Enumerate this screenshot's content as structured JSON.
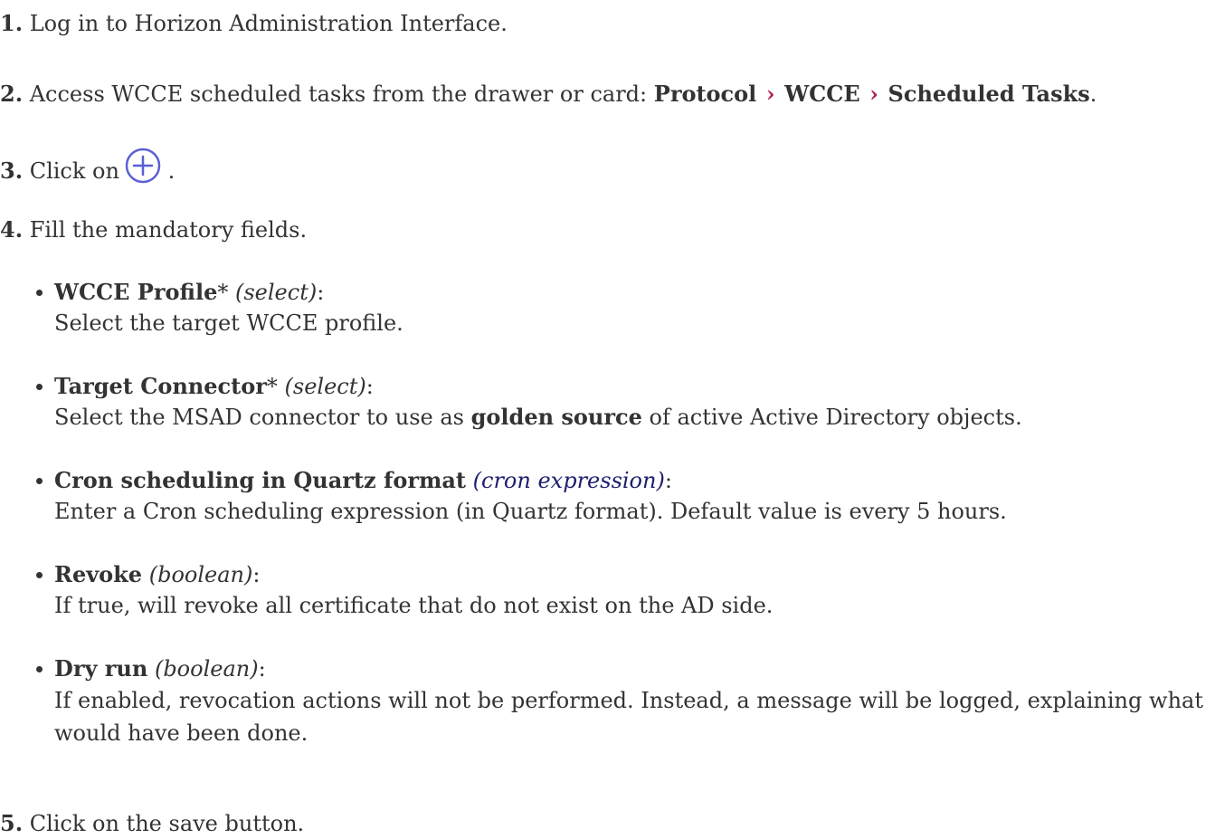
{
  "steps": {
    "s1": {
      "num": "1.",
      "text": "Log in to Horizon Administration Interface."
    },
    "s2": {
      "num": "2.",
      "text": "Access WCCE scheduled tasks from the drawer or card: ",
      "crumbs": [
        "Protocol",
        "WCCE",
        "Scheduled Tasks"
      ],
      "separator": "›",
      "end": "."
    },
    "s3": {
      "num": "3.",
      "text": "Click on",
      "end": ".",
      "icon": "add-circle-icon",
      "icon_color": "#5a5fd6"
    },
    "s4": {
      "num": "4.",
      "text": "Fill the mandatory fields."
    },
    "s5": {
      "num": "5.",
      "text": "Click on the save button."
    }
  },
  "fields": [
    {
      "name": "WCCE Profile",
      "required": "*",
      "type": "(select)",
      "colon": ":",
      "description": "Select the target WCCE profile."
    },
    {
      "name": "Target Connector",
      "required": "*",
      "type": "(select)",
      "colon": ":",
      "description_pre": "Select the MSAD connector to use as ",
      "description_bold": "golden source",
      "description_post": " of active Active Directory objects."
    },
    {
      "name": "Cron scheduling in Quartz format",
      "required": "",
      "type": "(cron expression)",
      "colon": ":",
      "description": "Enter a Cron scheduling expression (in Quartz format). Default value is every 5 hours."
    },
    {
      "name": "Revoke",
      "required": "",
      "type": "(boolean)",
      "colon": ":",
      "description": "If true, will revoke all certificate that do not exist on the AD side."
    },
    {
      "name": "Dry run",
      "required": "",
      "type": "(boolean)",
      "colon": ":",
      "description": "If enabled, revocation actions will not be performed. Instead, a message will be logged, explaining what would have been done."
    }
  ],
  "colors": {
    "text": "#333333",
    "breadcrumb_separator": "#b01e56",
    "link": "#1d1e6f",
    "icon": "#5a5fd6"
  }
}
